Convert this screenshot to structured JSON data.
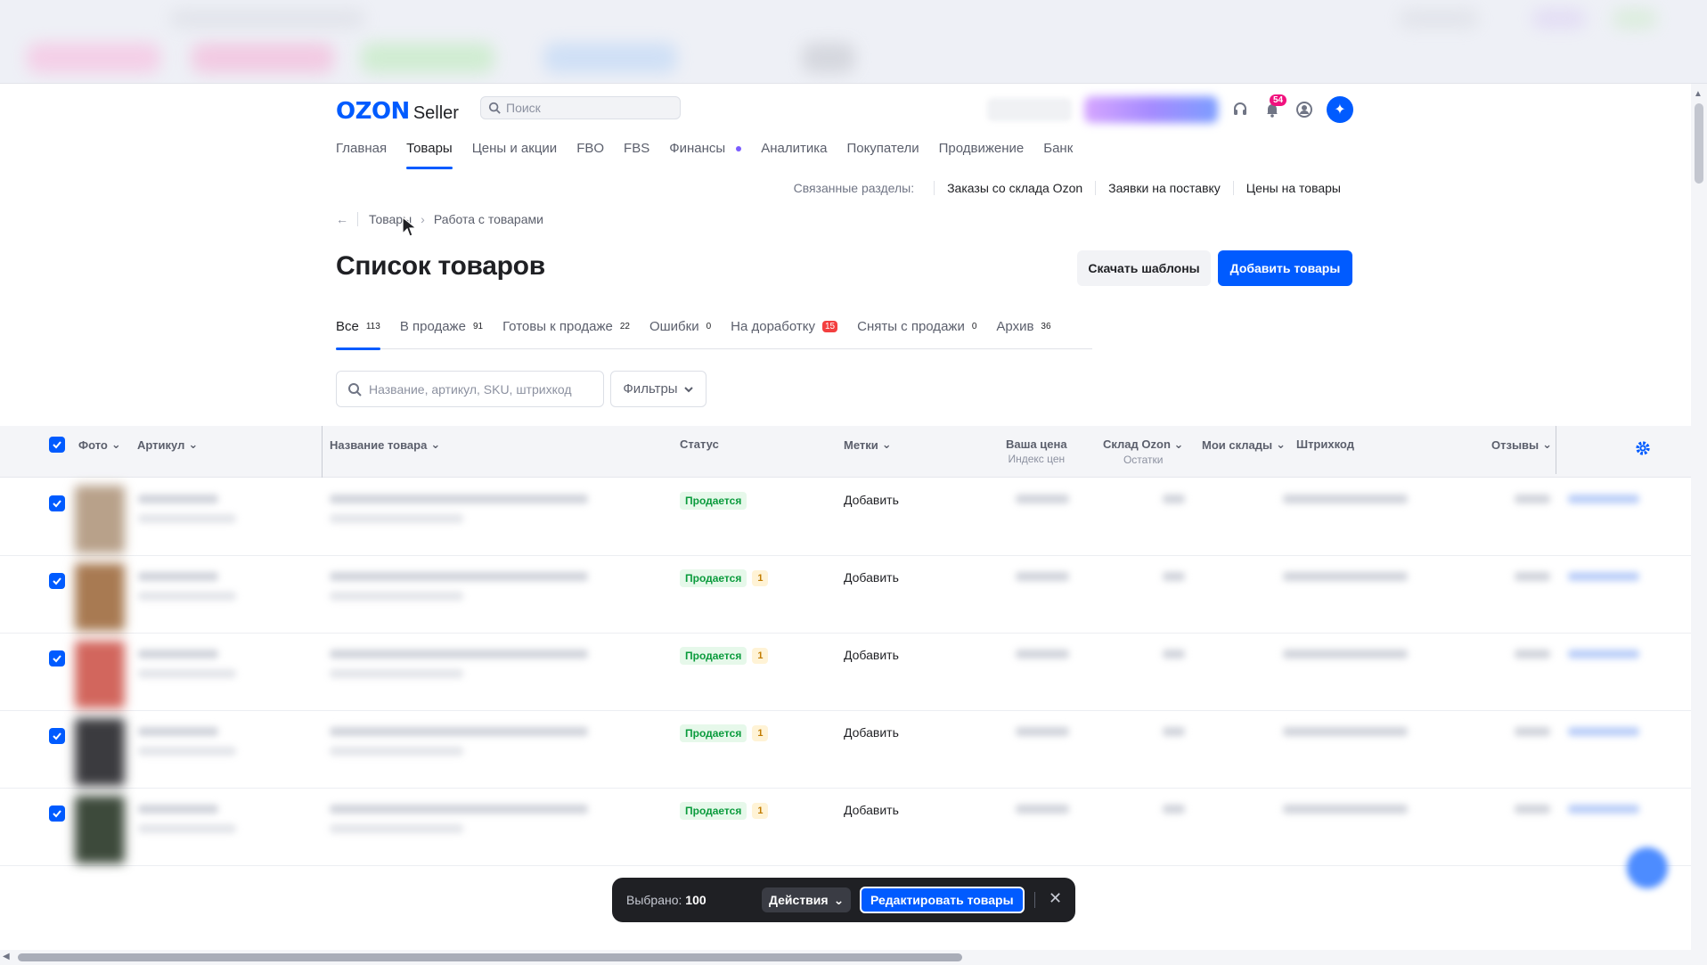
{
  "header": {
    "logo_brand": "OZON",
    "logo_suffix": "Seller",
    "search_placeholder": "Поиск",
    "notifications_count": "54"
  },
  "nav": [
    {
      "label": "Главная",
      "active": false
    },
    {
      "label": "Товары",
      "active": true
    },
    {
      "label": "Цены и акции",
      "active": false
    },
    {
      "label": "FBO",
      "active": false
    },
    {
      "label": "FBS",
      "active": false
    },
    {
      "label": "Финансы",
      "active": false
    },
    {
      "label": "Аналитика",
      "active": false
    },
    {
      "label": "Покупатели",
      "active": false
    },
    {
      "label": "Продвижение",
      "active": false
    },
    {
      "label": "Банк",
      "active": false
    }
  ],
  "related": {
    "label": "Связанные разделы:",
    "links": [
      "Заказы со склада Ozon",
      "Заявки на поставку",
      "Цены на товары"
    ]
  },
  "breadcrumb": {
    "root": "Товары",
    "current": "Работа с товарами"
  },
  "page": {
    "title": "Список товаров",
    "download_templates": "Скачать шаблоны",
    "add_products": "Добавить товары"
  },
  "tabs": [
    {
      "label": "Все",
      "count": "113",
      "active": true,
      "alert": false
    },
    {
      "label": "В продаже",
      "count": "91",
      "active": false,
      "alert": false
    },
    {
      "label": "Готовы к продаже",
      "count": "22",
      "active": false,
      "alert": false
    },
    {
      "label": "Ошибки",
      "count": "0",
      "active": false,
      "alert": false
    },
    {
      "label": "На доработку",
      "count": "15",
      "active": false,
      "alert": true
    },
    {
      "label": "Сняты с продажи",
      "count": "0",
      "active": false,
      "alert": false
    },
    {
      "label": "Архив",
      "count": "36",
      "active": false,
      "alert": false
    }
  ],
  "filters": {
    "search_placeholder": "Название, артикул, SKU, штрихкод",
    "filters_label": "Фильтры"
  },
  "table": {
    "columns": {
      "photo": "Фото",
      "article": "Артикул",
      "name": "Название товара",
      "status": "Статус",
      "tags": "Метки",
      "price": "Ваша цена",
      "price_sub": "Индекс цен",
      "ozon_stock": "Склад Ozon",
      "ozon_stock_sub": "Остатки",
      "my_stock": "Мои склады",
      "barcode": "Штрихкод",
      "reviews": "Отзывы"
    },
    "rows": [
      {
        "status": "Продается",
        "count": "",
        "tag": "Добавить"
      },
      {
        "status": "Продается",
        "count": "1",
        "tag": "Добавить"
      },
      {
        "status": "Продается",
        "count": "1",
        "tag": "Добавить"
      },
      {
        "status": "Продается",
        "count": "1",
        "tag": "Добавить"
      },
      {
        "status": "Продается",
        "count": "1",
        "tag": "Добавить"
      }
    ]
  },
  "bottombar": {
    "selected_label": "Выбрано:",
    "selected_count": "100",
    "actions": "Действия",
    "edit": "Редактировать товары"
  },
  "colors": {
    "accent": "#005bff",
    "dark": "#1f2024",
    "success": "#0a9b3c"
  }
}
